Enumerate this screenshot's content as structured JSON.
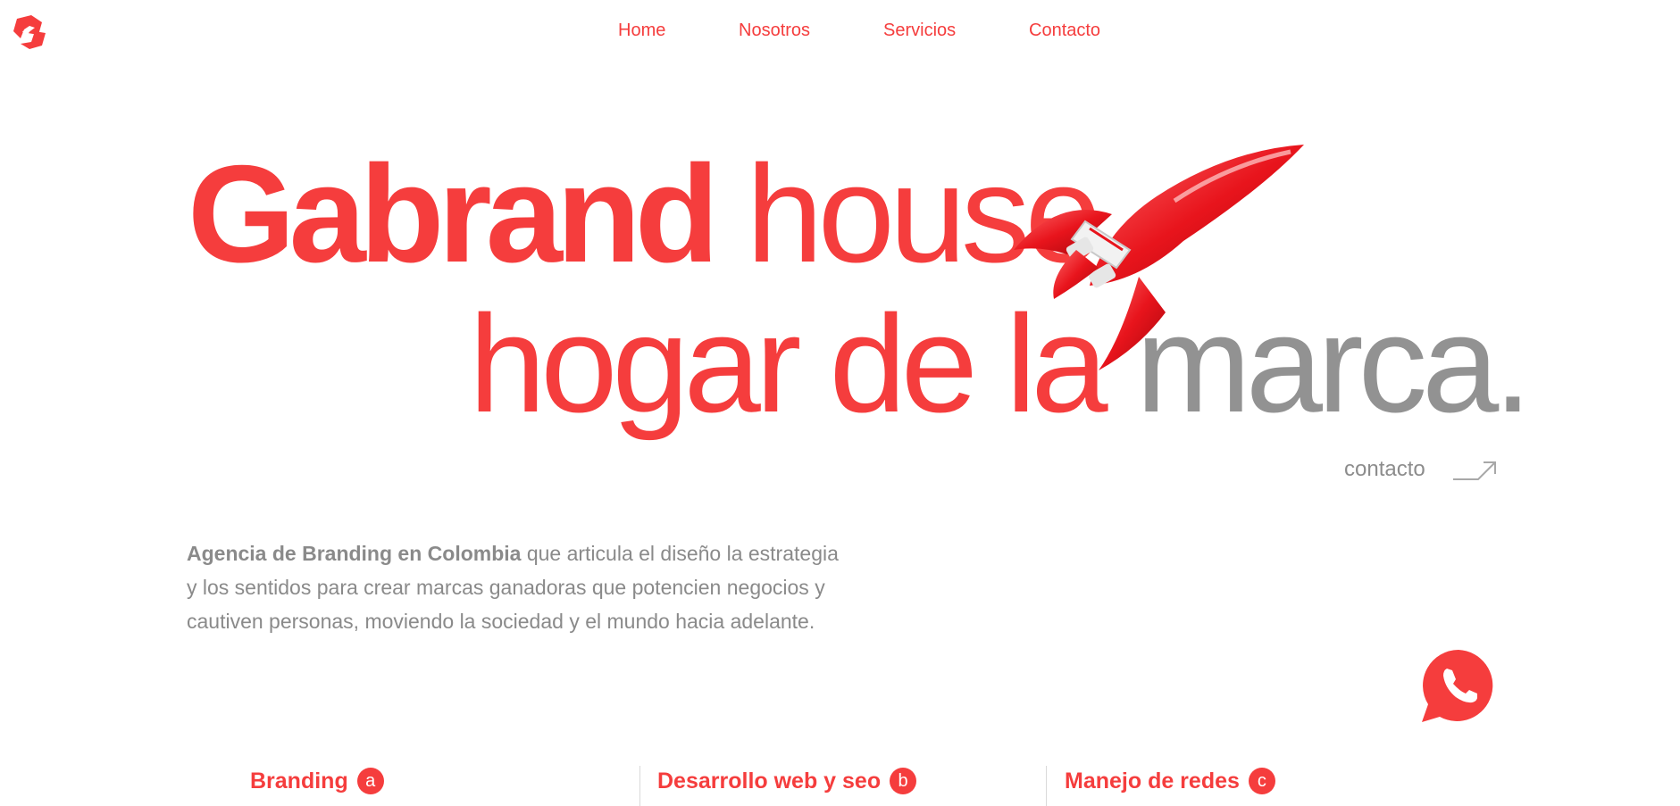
{
  "brand": {
    "logo_icon": "gabrand-logo-icon",
    "accent_color": "#f53d3d"
  },
  "nav": {
    "items": [
      {
        "label": "Home"
      },
      {
        "label": "Nosotros"
      },
      {
        "label": "Servicios"
      },
      {
        "label": "Contacto"
      }
    ]
  },
  "hero": {
    "line1_bold": "Gabrand",
    "line1_thin": "house",
    "line2_red": "hogar de la",
    "line2_gray": "marca.",
    "image": "rocket-illustration",
    "gray_color": "#929292"
  },
  "contact": {
    "label": "contacto",
    "icon": "arrow-up-right-icon"
  },
  "intro": {
    "strong": "Agencia de Branding en Colombia",
    "rest": " que articula el diseño la estrategia y los sentidos para crear marcas ganadoras que potencien negocios y cautiven personas, moviendo la sociedad y el mundo hacia adelante."
  },
  "whatsapp": {
    "icon": "whatsapp-phone-icon"
  },
  "services": [
    {
      "label": "Branding",
      "badge": "a"
    },
    {
      "label": "Desarrollo web y seo",
      "badge": "b"
    },
    {
      "label": "Manejo de redes",
      "badge": "c"
    }
  ]
}
